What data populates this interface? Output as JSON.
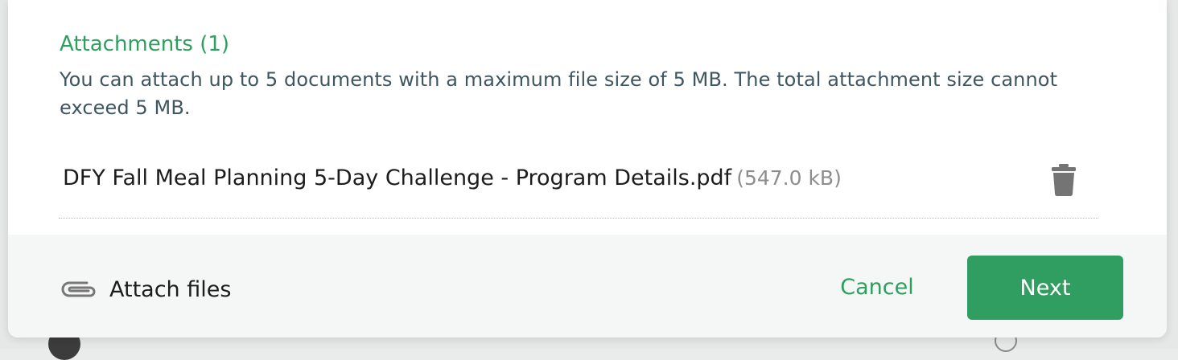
{
  "attachments": {
    "title": "Attachments (1)",
    "description": "You can attach up to 5 documents with a maximum file size of 5 MB. The total attachment size cannot exceed 5 MB.",
    "files": [
      {
        "name": "DFY Fall Meal Planning 5-Day Challenge - Program Details.pdf",
        "size": "(547.0 kB)",
        "delete_icon": "trash-icon"
      }
    ]
  },
  "footer": {
    "attach_label": "Attach files",
    "attach_icon": "paperclip-icon",
    "cancel_label": "Cancel",
    "next_label": "Next"
  },
  "colors": {
    "accent": "#2e9e5f",
    "primary_button": "#2f9e60",
    "description_text": "#3f5560",
    "size_text": "#8d8d8d",
    "footer_bg": "#f5f7f6"
  }
}
